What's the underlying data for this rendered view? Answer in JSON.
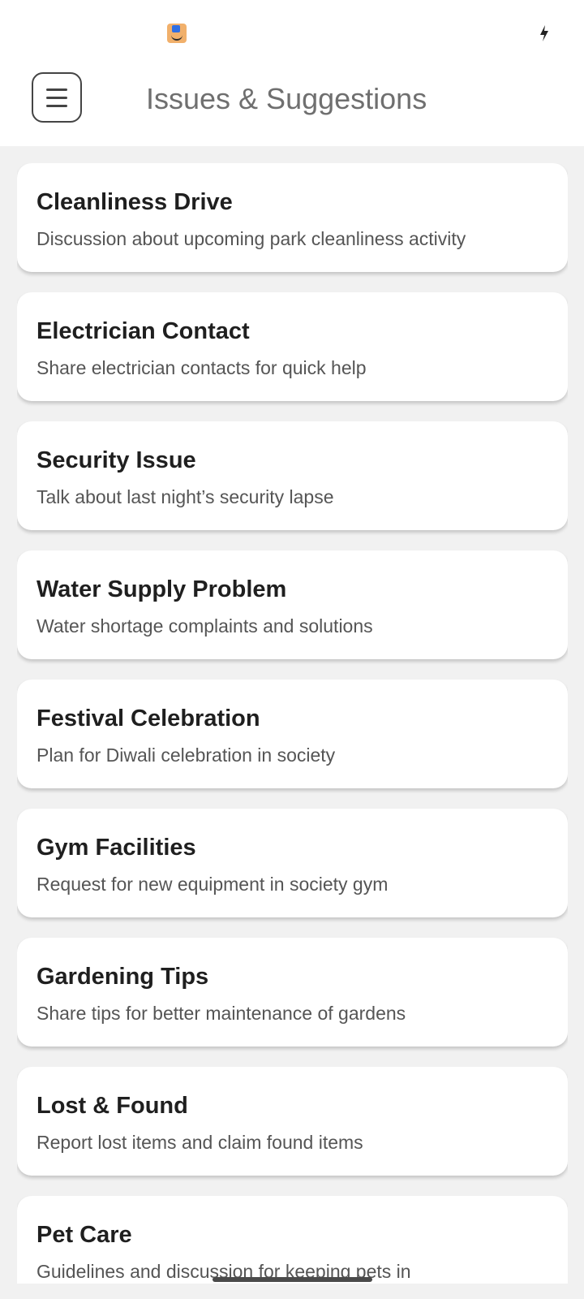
{
  "status_bar": {
    "app_icon": "amazon-app-icon",
    "right_icon": "charging-bolt-icon"
  },
  "app_bar": {
    "menu_icon": "hamburger-menu-icon",
    "title": "Issues & Suggestions"
  },
  "topics": [
    {
      "title": "Cleanliness Drive",
      "description": "Discussion about upcoming park cleanliness activity"
    },
    {
      "title": "Electrician Contact",
      "description": "Share electrician contacts for quick help"
    },
    {
      "title": "Security Issue",
      "description": "Talk about last night’s security lapse"
    },
    {
      "title": "Water Supply Problem",
      "description": "Water shortage complaints and solutions"
    },
    {
      "title": "Festival Celebration",
      "description": "Plan for Diwali celebration in society"
    },
    {
      "title": "Gym Facilities",
      "description": "Request for new equipment in society gym"
    },
    {
      "title": "Gardening Tips",
      "description": "Share tips for better maintenance of gardens"
    },
    {
      "title": "Lost & Found",
      "description": "Report lost items and claim found items"
    },
    {
      "title": "Pet Care",
      "description": "Guidelines and discussion for keeping pets in"
    }
  ],
  "colors": {
    "background": "#f1f1f1",
    "card": "#ffffff",
    "title_text": "#1f1f1f",
    "description_text": "#555555",
    "app_bar_title": "#6f6f6f"
  }
}
